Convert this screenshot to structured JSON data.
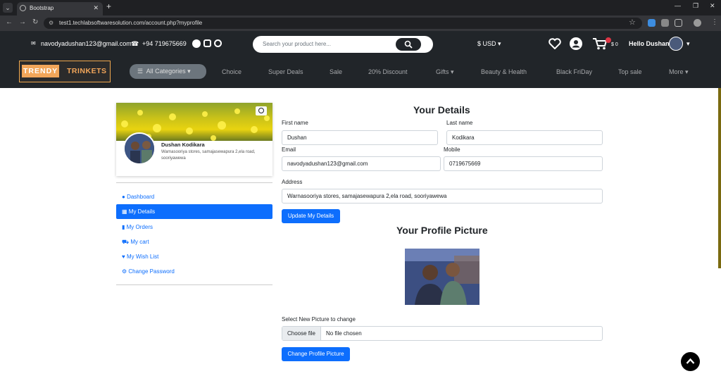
{
  "browser": {
    "tab_title": "Bootstrap",
    "url": "test1.techlabsoftwaresolution.com/account.php?myprofile"
  },
  "topbar": {
    "email": "navodyadushan123@gmail.com",
    "phone": "+94 719675669",
    "search_placeholder": "Search your product here...",
    "currency": "$ USD",
    "cart_amount": "$ 0",
    "greeting": "Hello Dushan"
  },
  "navbar": {
    "logo_part1": "TRENDY",
    "logo_part2": "TRINKETS",
    "all_categories": "All Categories",
    "links": [
      "Choice",
      "Super Deals",
      "Sale",
      "20% Discount",
      "Gifts",
      "Beauty & Health",
      "Black FriDay",
      "Top sale",
      "More"
    ]
  },
  "profile_card": {
    "name": "Dushan Kodikara",
    "address": "Warnasooriya stores, samajasewapura 2,ela road, sooriyawewa"
  },
  "sidebar": {
    "items": [
      {
        "label": "Dashboard",
        "icon": "globe-icon"
      },
      {
        "label": "My Details",
        "icon": "table-icon"
      },
      {
        "label": "My Orders",
        "icon": "book-icon"
      },
      {
        "label": "My cart",
        "icon": "cart-icon"
      },
      {
        "label": "My Wish List",
        "icon": "heart-icon"
      },
      {
        "label": "Change Password",
        "icon": "gear-icon"
      }
    ]
  },
  "details": {
    "title": "Your Details",
    "first_name_label": "First name",
    "first_name": "Dushan",
    "last_name_label": "Last name",
    "last_name": "Kodikara",
    "email_label": "Email",
    "email": "navodyadushan123@gmail.com",
    "mobile_label": "Mobile",
    "mobile": "0719675669",
    "address_label": "Address",
    "address": "Warnasooriya stores, samajasewapura 2,ela road, sooriyawewa",
    "update_button": "Update My Details"
  },
  "picture": {
    "title": "Your Profile Picture",
    "select_label": "Select New Picture to change",
    "choose_file": "Choose file",
    "no_file": "No file chosen",
    "change_button": "Change Profile Picture"
  },
  "colors": {
    "primary": "#0d6efd",
    "dark": "#212529",
    "logo_accent": "#f2a65a"
  }
}
